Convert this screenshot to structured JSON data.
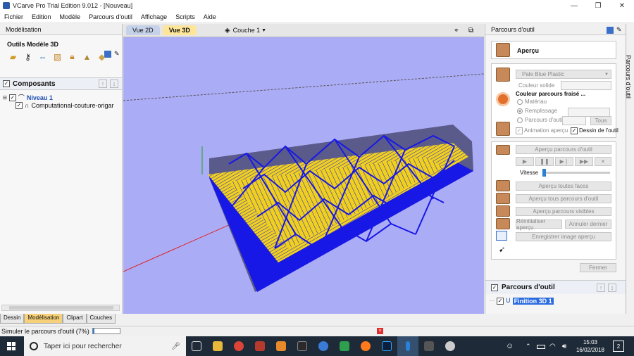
{
  "window": {
    "title": "VCarve Pro Trial Edition 9.012 - [Nouveau]",
    "controls": [
      "—",
      "❐",
      "✕"
    ]
  },
  "menu": [
    "Fichier",
    "Edition",
    "Modèle",
    "Parcours d'outil",
    "Affichage",
    "Scripts",
    "Aide"
  ],
  "left_panel": {
    "header": "Modélisation",
    "tools_title": "Outils Modèle 3D",
    "components_title": "Composants",
    "tree": {
      "level": "Niveau 1",
      "item": "Computational-couture-origar"
    },
    "tabs": [
      "Dessin",
      "Modélisation",
      "Clipart",
      "Couches"
    ],
    "active_tab": "Modélisation"
  },
  "view": {
    "tabs": [
      "Vue 2D",
      "Vue 3D"
    ],
    "active_tab": "Vue 3D",
    "layer": "Couche 1"
  },
  "right_panel": {
    "header": "Parcours d'outil",
    "side_tab": "Parcours d'outil",
    "apercu": "Aperçu",
    "material_select": "Pale Blue Plastic",
    "couleur_solide": "Couleur solide",
    "couleur_parcours": "Couleur parcours fraisé ...",
    "radios": [
      "Matériau",
      "Remplissage",
      "Parcours d'outil"
    ],
    "tous": "Tous",
    "animation": "Animation aperçu",
    "dessin_outil": "Dessin de l'outil",
    "apercu_parcours": "Aperçu parcours d'outil",
    "vitesse": "Vitesse",
    "apercu_faces": "Aperçu toutes faces",
    "apercu_tous": "Aperçu tous parcours d'outil",
    "apercu_visibles": "Aperçu parcours visibles",
    "reinitialiser": "Réinitialiser aperçu",
    "annuler": "Annuler dernier",
    "enregistrer": "Enregistrer image aperçu",
    "fermer": "Fermer",
    "toolpaths_title": "Parcours d'outil",
    "toolpath_item": "Finition 3D 1"
  },
  "status": {
    "text": "Simuler le parcours d'outil (7%)",
    "progress": 0.07
  },
  "taskbar": {
    "search": "Taper ici pour rechercher",
    "time": "15:03",
    "date": "16/02/2018",
    "notifications": "2"
  },
  "colors": {
    "viewport": "#abacf6",
    "toolpath": "#1818e6",
    "material": "#f2d21c",
    "taskbar": "#1e2a38"
  }
}
